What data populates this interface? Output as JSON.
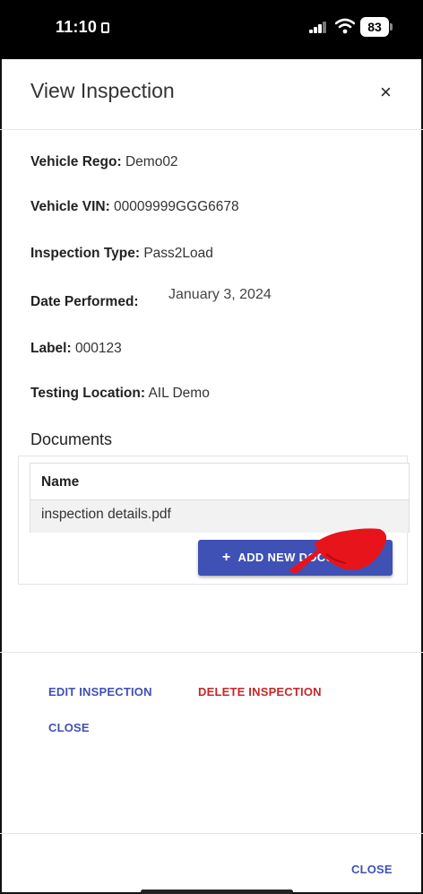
{
  "status": {
    "time": "11:10",
    "battery": "83"
  },
  "header": {
    "title": "View Inspection",
    "close_icon": "×"
  },
  "fields": {
    "rego_label": "Vehicle Rego:",
    "rego_value": "Demo02",
    "vin_label": "Vehicle VIN:",
    "vin_value": "00009999GGG6678",
    "type_label": "Inspection Type:",
    "type_value": "Pass2Load",
    "date_label": "Date Performed:",
    "date_value": "January 3, 2024",
    "label_label": "Label:",
    "label_value": "000123",
    "location_label": "Testing Location:",
    "location_value": "AIL Demo"
  },
  "documents": {
    "heading": "Documents",
    "column_name": "Name",
    "rows": [
      {
        "name": "inspection details.pdf"
      }
    ],
    "add_button": "ADD NEW DOCUMENT",
    "add_icon": "+"
  },
  "actions": {
    "edit": "EDIT INSPECTION",
    "delete": "DELETE INSPECTION",
    "close": "CLOSE"
  },
  "footer": {
    "close": "CLOSE"
  },
  "colors": {
    "primary": "#3f51b5",
    "danger": "#c62828",
    "pointer": "#e8141b"
  }
}
